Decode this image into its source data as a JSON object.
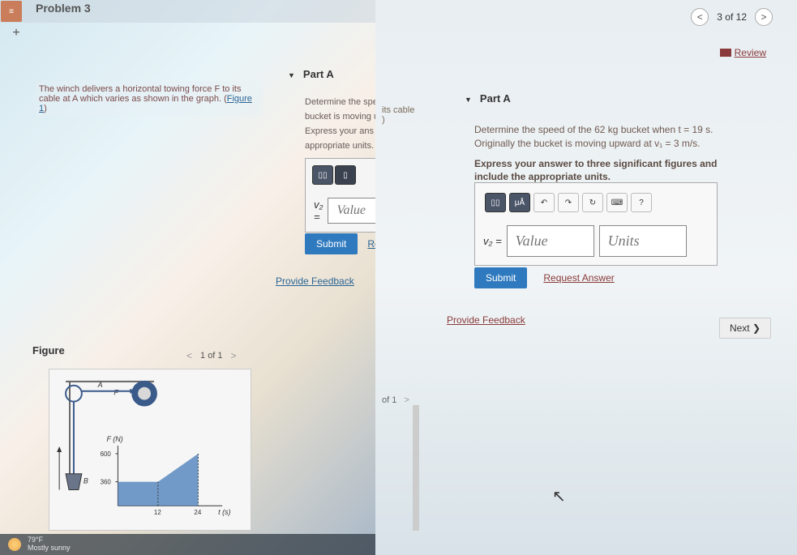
{
  "left": {
    "problem_title": "Problem 3",
    "statement_a": "The winch delivers a horizontal towing force F to its cable at A which varies as shown in the graph. (",
    "statement_link": "Figure 1",
    "statement_b": ")",
    "part_label": "Part A",
    "body_line1": "Determine the spee",
    "body_line2": "bucket is moving up",
    "body_line3": "Express your ans",
    "body_line4": "appropriate units.",
    "eq_label": "v₂ =",
    "value_placeholder": "Value",
    "submit": "Submit",
    "request": "Req",
    "feedback": "Provide Feedback",
    "figure_title": "Figure",
    "figure_nav": "1 of 1",
    "stray_cable": "its cable",
    "weather_temp": "79°F",
    "weather_desc": "Mostly sunny"
  },
  "right": {
    "nav_count": "3 of 12",
    "review": "Review",
    "part_label": "Part A",
    "body_line1": "Determine the speed of the 62 kg bucket when t = 19 s. Originally the bucket is moving upward at v₁ = 3 m/s.",
    "body_line2": "Express your answer to three significant figures and include the appropriate units.",
    "eq_label": "v₂ =",
    "value_placeholder": "Value",
    "units_placeholder": "Units",
    "tool_ua": "μÅ",
    "tool_q": "?",
    "submit": "Submit",
    "request": "Request Answer",
    "feedback": "Provide Feedback",
    "next": "Next ❯",
    "of1": "of 1",
    "stray_cable": "its cable"
  },
  "chart_data": {
    "type": "area",
    "title": "",
    "xlabel": "t (s)",
    "ylabel": "F (N)",
    "x": [
      0,
      12,
      24
    ],
    "y": [
      360,
      360,
      600
    ],
    "xlim": [
      0,
      24
    ],
    "ylim": [
      0,
      600
    ],
    "annotations": [
      "A",
      "F",
      "B"
    ]
  }
}
